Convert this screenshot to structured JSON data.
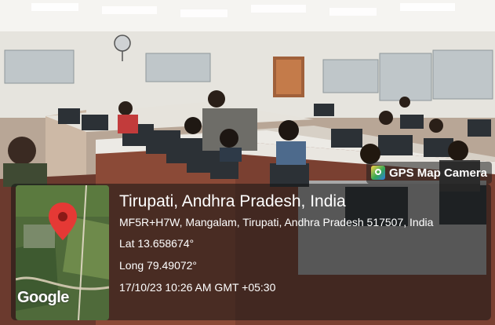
{
  "app_badge": {
    "label": "GPS Map Camera",
    "icon": "gps-map-camera-icon"
  },
  "location": {
    "title": "Tirupati, Andhra Pradesh, India",
    "address": "MF5R+H7W, Mangalam, Tirupati, Andhra Pradesh 517507, India",
    "lat": "Lat 13.658674°",
    "long": "Long 79.49072°",
    "timestamp": "17/10/23 10:26 AM GMT +05:30"
  },
  "map": {
    "provider_label": "Google",
    "pin_color": "#e53935"
  }
}
